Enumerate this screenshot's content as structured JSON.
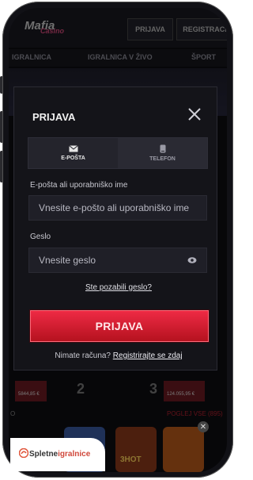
{
  "site": {
    "logo_main": "Mafia",
    "logo_sub": "Casino",
    "header_login": "PRIJAVA",
    "header_register": "REGISTRACI",
    "nav": [
      "IGRALNICA",
      "IGRALNICA V ŽIVO",
      "ŠPORT"
    ],
    "bg_amounts": [
      "5844,85 €",
      "124.055,95 €"
    ],
    "bg_numbers": [
      "2",
      "3"
    ],
    "bg_row_left": "O",
    "bg_row_right": "POGLEJ VSE (895)",
    "bg_game_label": "3HOT"
  },
  "modal": {
    "title": "PRIJAVA",
    "tabs": [
      {
        "label": "E-POŠTA",
        "icon": "envelope-icon",
        "active": true
      },
      {
        "label": "TELEFON",
        "icon": "phone-icon",
        "active": false
      }
    ],
    "email_label": "E-pošta ali uporabniško ime",
    "email_placeholder": "Vnesite e-pošto ali uporabniško ime",
    "password_label": "Geslo",
    "password_placeholder": "Vnesite geslo",
    "forgot": "Ste pozabili geslo?",
    "submit": "PRIJAVA",
    "no_account": "Nimate računa?",
    "register_link": "Registrirajte se zdaj"
  },
  "badge": {
    "brand_left": "Spletne",
    "brand_right": "igralnice"
  },
  "colors": {
    "accent": "#d9182e",
    "modal_bg": "#141419",
    "field_bg": "#1f1f27"
  }
}
